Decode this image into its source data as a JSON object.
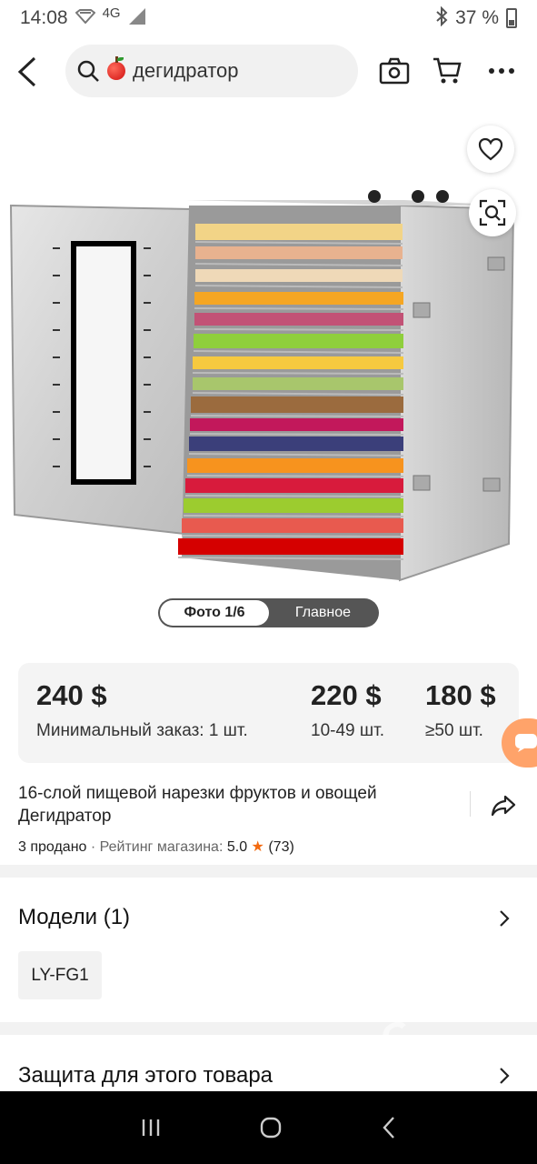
{
  "status": {
    "time": "14:08",
    "network": "4G",
    "battery": "37 %"
  },
  "search": {
    "query": "дегидратор"
  },
  "gallery": {
    "photo_counter": "Фото 1/6",
    "main_tab": "Главное"
  },
  "prices": [
    {
      "value": "240 $",
      "label": "Минимальный заказ: 1 шт."
    },
    {
      "value": "220 $",
      "label": "10-49 шт."
    },
    {
      "value": "180 $",
      "label": "≥50 шт."
    }
  ],
  "product": {
    "title": "16-слой пищевой нарезки фруктов и овощей Дегидратор",
    "sold": "3 продано",
    "rating_label": "· Рейтинг магазина:",
    "rating_value": "5.0",
    "reviews": "(73)"
  },
  "models": {
    "title": "Модели (1)",
    "chip": "LY-FG1"
  },
  "protection": {
    "title": "Защита для этого товара"
  },
  "watermark": "TMC",
  "colors": {
    "accent": "#f36a10",
    "chat_fab": "#ffa36a"
  }
}
